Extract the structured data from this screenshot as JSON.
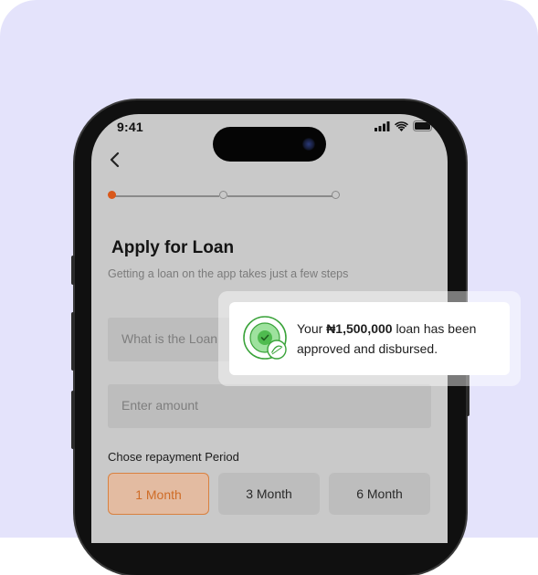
{
  "status_bar": {
    "time": "9:41"
  },
  "steps": {
    "total": 3,
    "current": 1
  },
  "form": {
    "title": "Apply for Loan",
    "subtitle": "Getting a loan on the app takes just a few steps",
    "purpose_placeholder": "What is the Loan",
    "amount_placeholder": "Enter amount",
    "repayment_label": "Chose repayment Period",
    "repayment_options": [
      "1 Month",
      "3 Month",
      "6 Month"
    ],
    "selected_option": "1 Month"
  },
  "toast": {
    "prefix": "Your ",
    "amount": "₦1,500,000",
    "suffix": " loan has been approved and disbursed."
  },
  "colors": {
    "accent": "#d9813f",
    "success": "#4fbb4f",
    "card_background": "#e4e3fb"
  },
  "icons": [
    "back-arrow-icon",
    "signal-icon",
    "wifi-icon",
    "battery-icon",
    "success-badge-icon"
  ]
}
